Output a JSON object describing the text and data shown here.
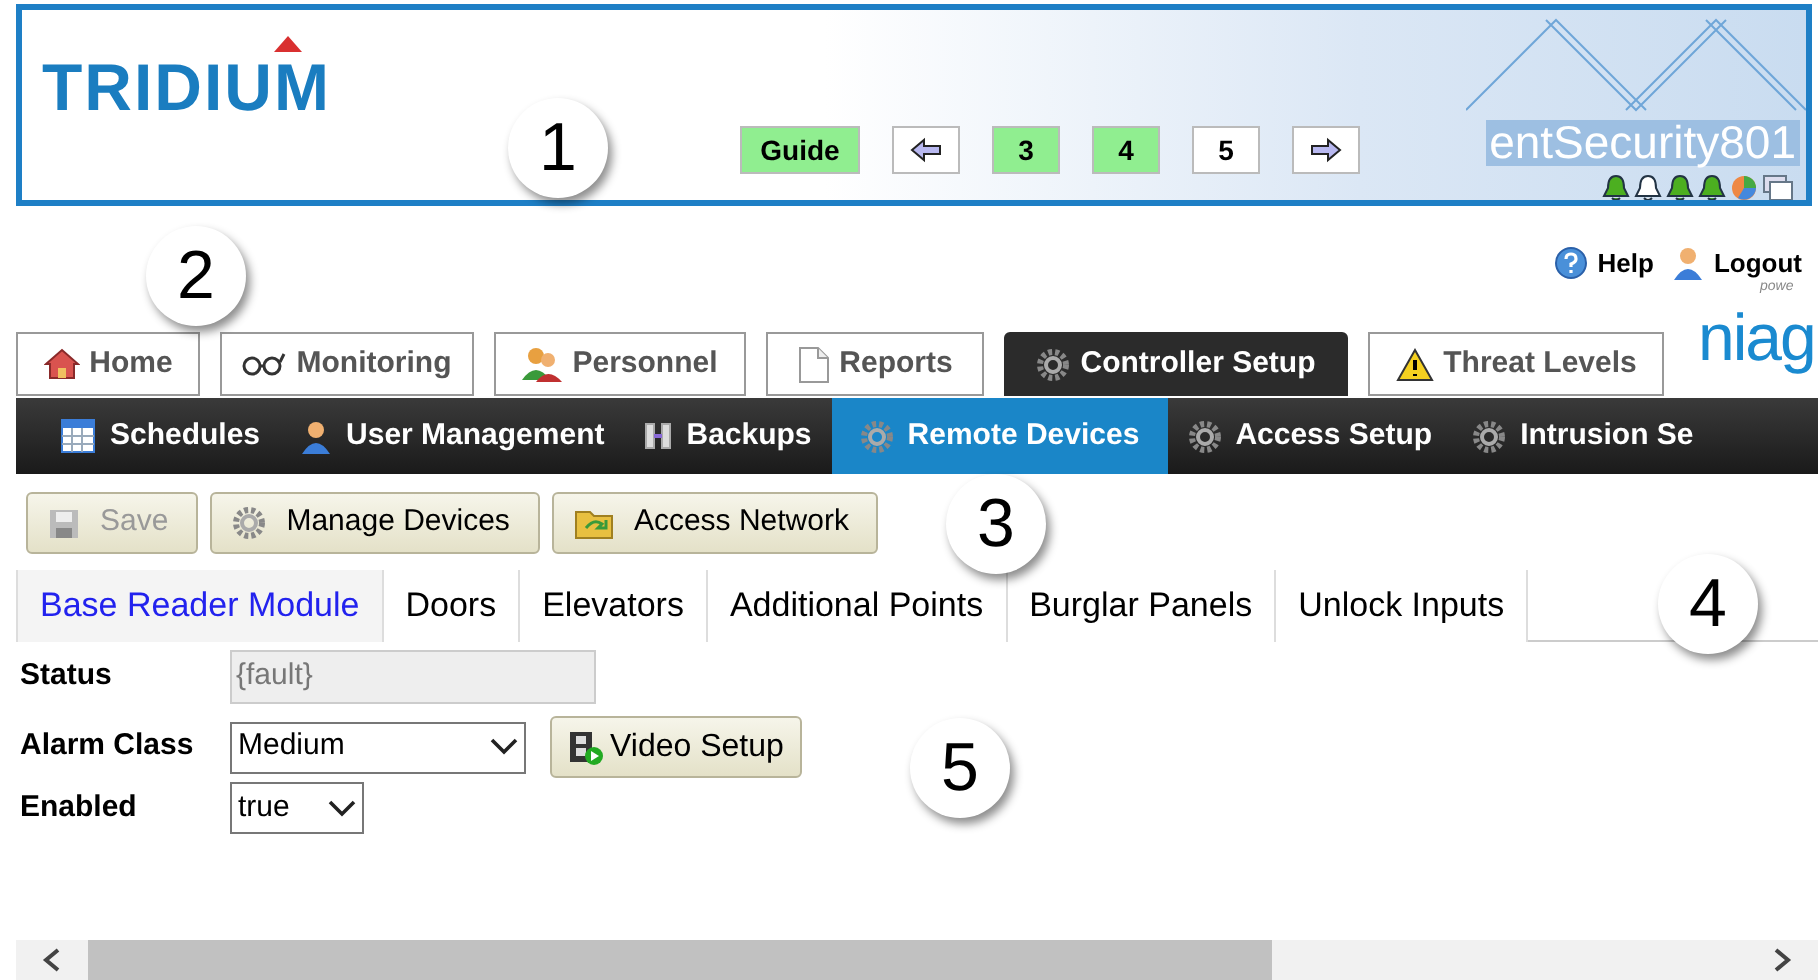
{
  "header": {
    "logo": "TRIDIUM",
    "nav_buttons": [
      {
        "kind": "text",
        "label": "Guide",
        "highlighted": true
      },
      {
        "kind": "prev"
      },
      {
        "kind": "text",
        "label": "3",
        "highlighted": true
      },
      {
        "kind": "text",
        "label": "4",
        "highlighted": true
      },
      {
        "kind": "text",
        "label": "5",
        "highlighted": false
      },
      {
        "kind": "next"
      }
    ],
    "station": "entSecurity801",
    "bells": [
      {
        "lit": true
      },
      {
        "lit": false
      },
      {
        "lit": true
      },
      {
        "lit": true
      }
    ]
  },
  "top_links": [
    {
      "label": "Help"
    },
    {
      "label": "Logout"
    }
  ],
  "brand": {
    "tagline": "powe",
    "name": "niag"
  },
  "main_tabs": [
    {
      "label": "Home",
      "selected": false
    },
    {
      "label": "Monitoring",
      "selected": false
    },
    {
      "label": "Personnel",
      "selected": false
    },
    {
      "label": "Reports",
      "selected": false
    },
    {
      "label": "Controller Setup",
      "selected": true
    },
    {
      "label": "Threat Levels",
      "selected": false
    }
  ],
  "sub_tabs": [
    {
      "label": "Schedules",
      "selected": false
    },
    {
      "label": "User Management",
      "selected": false
    },
    {
      "label": "Backups",
      "selected": false
    },
    {
      "label": "Remote Devices",
      "selected": true
    },
    {
      "label": "Access Setup",
      "selected": false
    },
    {
      "label": "Intrusion Se",
      "selected": false
    }
  ],
  "toolbar": [
    {
      "label": "Save",
      "disabled": true
    },
    {
      "label": "Manage Devices",
      "disabled": false
    },
    {
      "label": "Access Network",
      "disabled": false
    }
  ],
  "module_tabs": [
    {
      "label": "Base Reader Module",
      "selected": true
    },
    {
      "label": "Doors",
      "selected": false
    },
    {
      "label": "Elevators",
      "selected": false
    },
    {
      "label": "Additional Points",
      "selected": false
    },
    {
      "label": "Burglar Panels",
      "selected": false
    },
    {
      "label": "Unlock Inputs",
      "selected": false
    }
  ],
  "form": {
    "status": {
      "label": "Status",
      "value": "{fault}",
      "read_only": true
    },
    "alarm_class": {
      "label": "Alarm Class",
      "value": "Medium"
    },
    "video_button": "Video Setup",
    "enabled": {
      "label": "Enabled",
      "value": "true"
    }
  },
  "callouts": [
    "1",
    "2",
    "3",
    "4",
    "5"
  ]
}
